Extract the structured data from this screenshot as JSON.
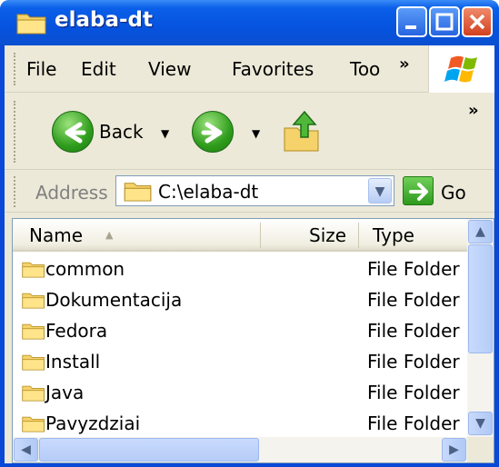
{
  "window": {
    "title": "elaba-dt"
  },
  "menu": [
    "File",
    "Edit",
    "View",
    "Favorites",
    "Too",
    "»"
  ],
  "toolbar": {
    "back_label": "Back",
    "more": "»"
  },
  "address": {
    "label": "Address",
    "value": "C:\\elaba-dt",
    "go_label": "Go"
  },
  "columns": {
    "name": "Name",
    "size": "Size",
    "type": "Type"
  },
  "files": [
    {
      "name": "common",
      "type": "File Folder"
    },
    {
      "name": "Dokumentacija",
      "type": "File Folder"
    },
    {
      "name": "Fedora",
      "type": "File Folder"
    },
    {
      "name": "Install",
      "type": "File Folder"
    },
    {
      "name": "Java",
      "type": "File Folder"
    },
    {
      "name": "Pavyzdziai",
      "type": "File Folder"
    }
  ],
  "icons": [
    "folder-icon",
    "minimize-icon",
    "maximize-icon",
    "close-icon",
    "windows-logo-icon",
    "back-arrow-icon",
    "forward-arrow-icon",
    "up-folder-icon",
    "go-arrow-icon",
    "sort-ascending-icon",
    "chevron-down-icon"
  ],
  "colors": {
    "title_bar": "#0a5fe8",
    "frame": "#ece9d8",
    "go_green": "#2e9a1e"
  }
}
